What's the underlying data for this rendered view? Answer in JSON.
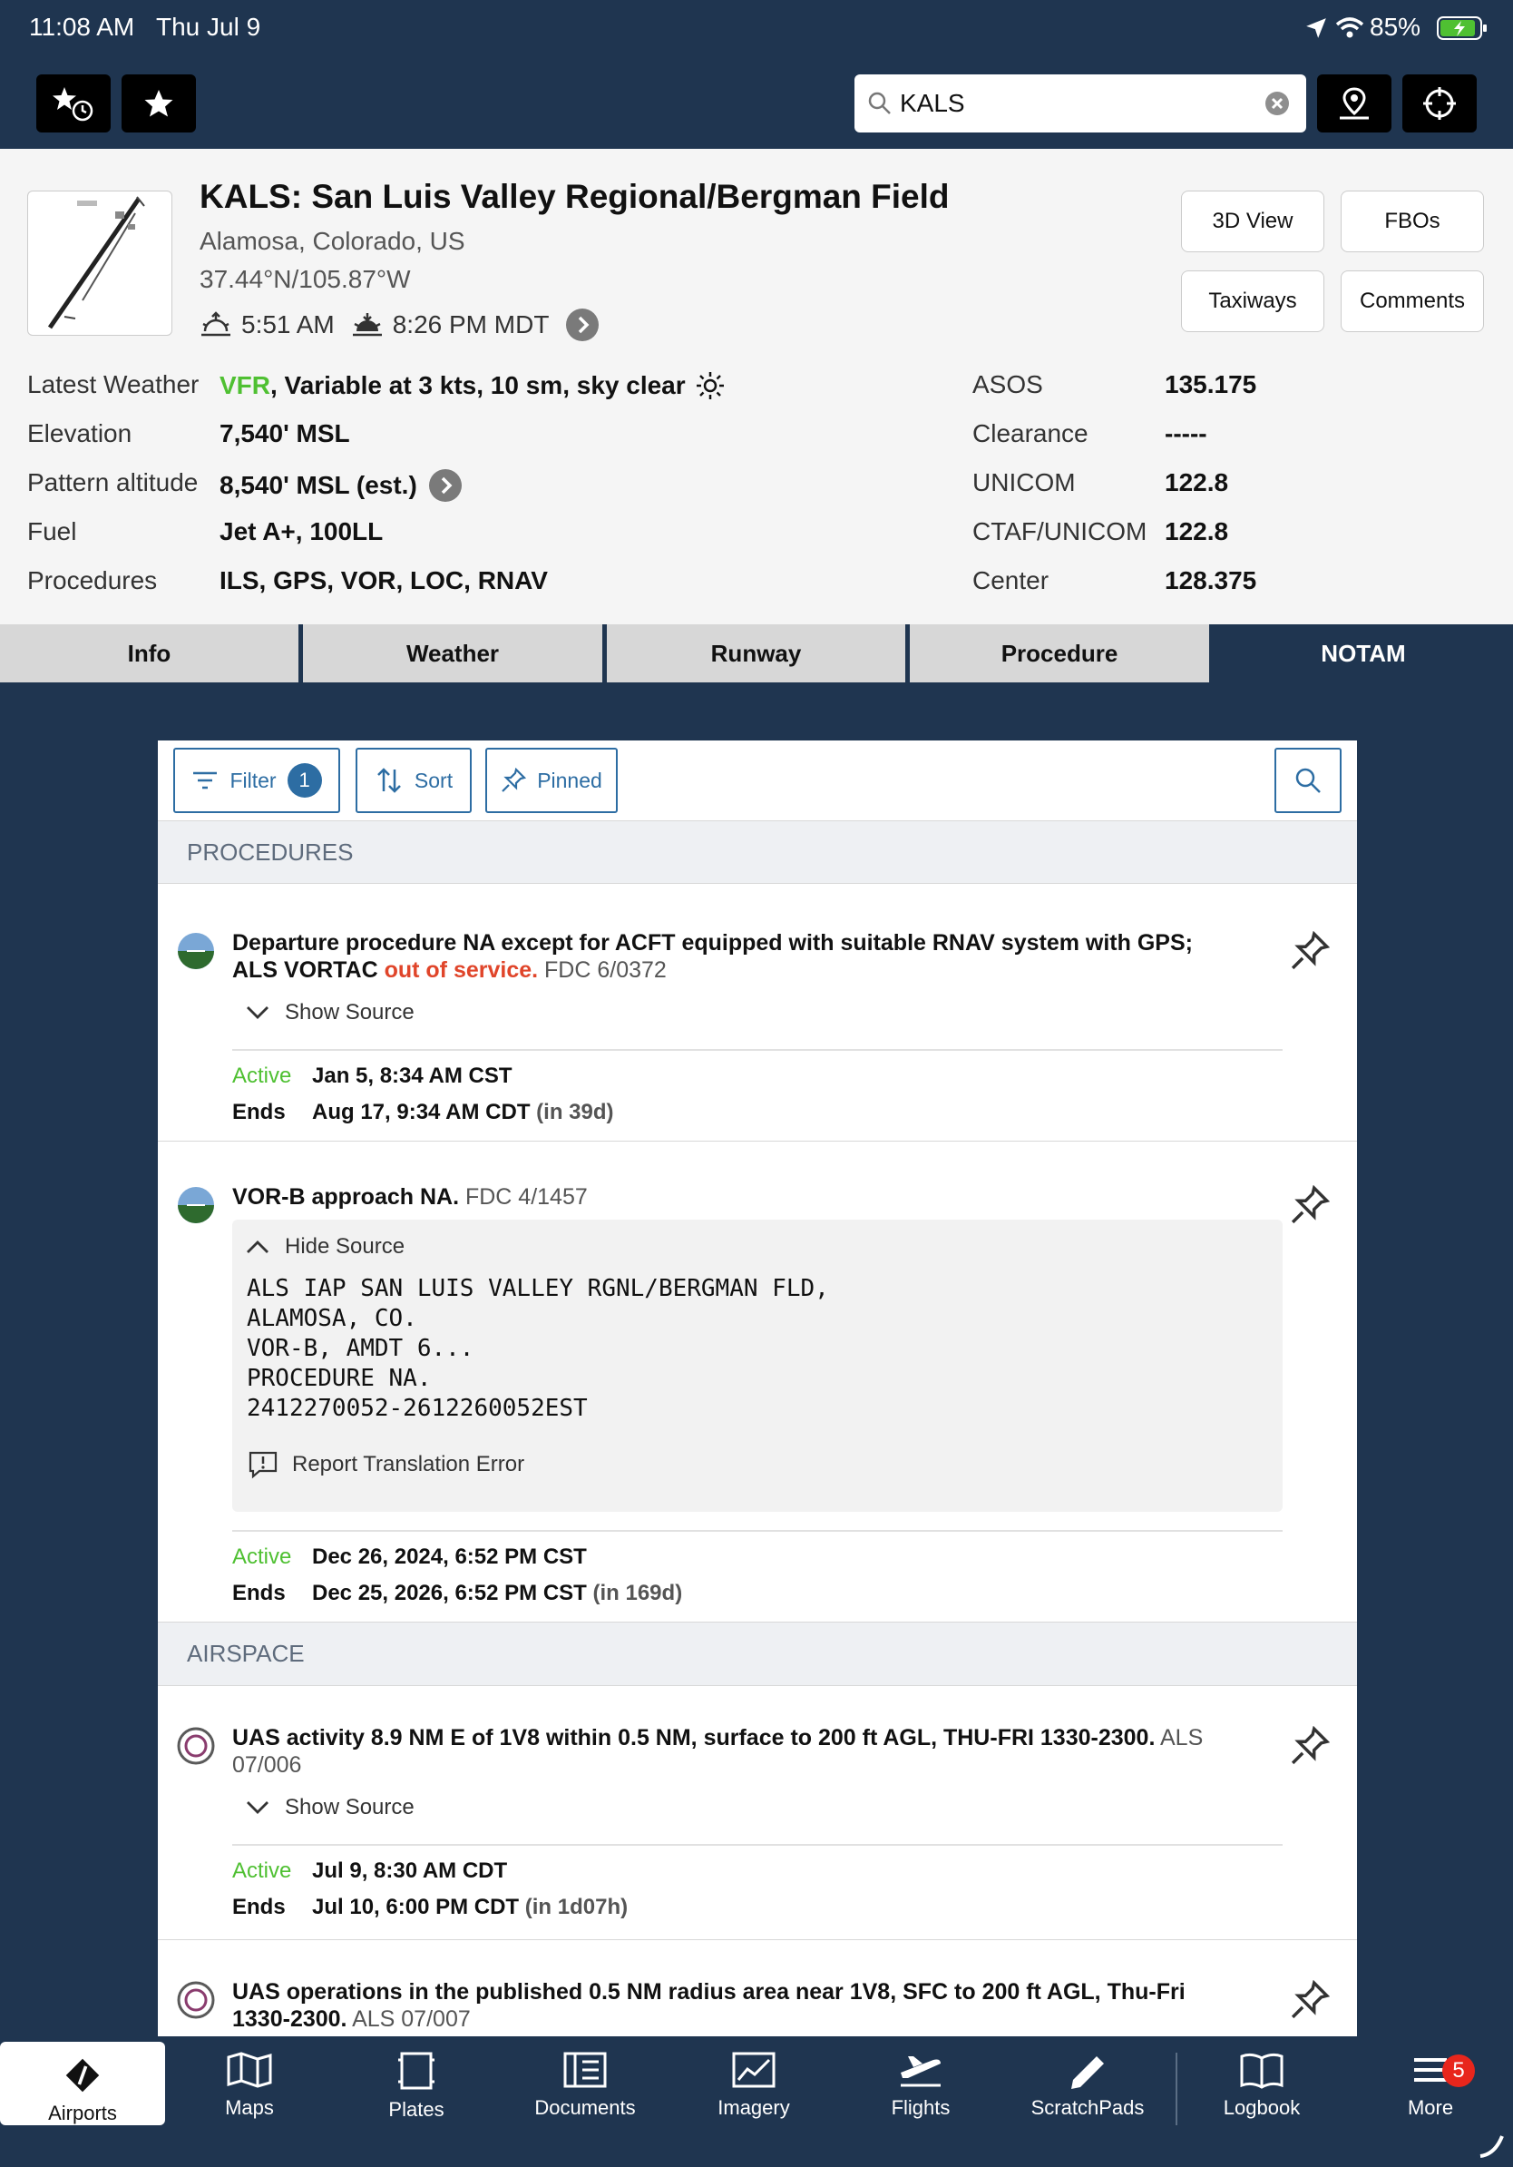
{
  "status_bar": {
    "time": "11:08 AM",
    "date": "Thu Jul 9",
    "battery": "85%"
  },
  "search": {
    "value": "KALS"
  },
  "airport": {
    "title": "KALS: San Luis Valley Regional/Bergman Field",
    "location": "Alamosa, Colorado, US",
    "coords": "37.44°N/105.87°W",
    "sunrise": "5:51 AM",
    "sunset": "8:26 PM MDT",
    "buttons": {
      "view3d": "3D View",
      "fbos": "FBOs",
      "taxiways": "Taxiways",
      "comments": "Comments"
    }
  },
  "info": {
    "weather_label": "Latest Weather",
    "weather_cat": "VFR",
    "weather_text": ", Variable at 3 kts, 10 sm, sky clear",
    "elevation_label": "Elevation",
    "elevation": "7,540' MSL",
    "pattern_label": "Pattern altitude",
    "pattern": "8,540' MSL (est.)",
    "fuel_label": "Fuel",
    "fuel": "Jet A+, 100LL",
    "procedures_label": "Procedures",
    "procedures": "ILS, GPS, VOR, LOC, RNAV",
    "asos_label": "ASOS",
    "asos": "135.175",
    "clearance_label": "Clearance",
    "clearance": "-----",
    "unicom_label": "UNICOM",
    "unicom": "122.8",
    "ctaf_label": "CTAF/UNICOM",
    "ctaf": "122.8",
    "center_label": "Center",
    "center": "128.375"
  },
  "tabs": [
    "Info",
    "Weather",
    "Runway",
    "Procedure",
    "NOTAM"
  ],
  "toolbar": {
    "filter": "Filter",
    "filter_count": "1",
    "sort": "Sort",
    "pinned": "Pinned"
  },
  "sections": {
    "procedures": "PROCEDURES",
    "airspace": "AIRSPACE"
  },
  "notams": [
    {
      "text_a": "Departure procedure NA except for ACFT equipped with suitable RNAV system with GPS; ALS VORTAC ",
      "text_red": "out of service.",
      "id": " FDC 6/0372",
      "toggle": "Show Source",
      "active_label": "Active",
      "active": "Jan 5, 8:34 AM CST",
      "ends_label": "Ends",
      "ends": "Aug 17, 9:34 AM CDT",
      "rel": "(in 39d)"
    },
    {
      "text_a": "VOR-B approach NA.",
      "id": " FDC 4/1457",
      "toggle": "Hide Source",
      "source": [
        "ALS IAP SAN LUIS VALLEY RGNL/BERGMAN FLD,",
        "ALAMOSA, CO.",
        "VOR-B, AMDT 6...",
        "PROCEDURE NA.",
        "2412270052-2612260052EST"
      ],
      "report": "Report Translation Error",
      "active_label": "Active",
      "active": "Dec 26, 2024, 6:52 PM CST",
      "ends_label": "Ends",
      "ends": "Dec 25, 2026, 6:52 PM CST",
      "rel": "(in 169d)"
    },
    {
      "text_a": "UAS activity 8.9 NM E of 1V8 within 0.5 NM, surface to 200 ft AGL, THU-FRI 1330-2300.",
      "id": " ALS 07/006",
      "toggle": "Show Source",
      "active_label": "Active",
      "active": "Jul 9, 8:30 AM CDT",
      "ends_label": "Ends",
      "ends": "Jul 10, 6:00 PM CDT",
      "rel": "(in 1d07h)"
    },
    {
      "text_a": "UAS operations in the published 0.5 NM radius area near 1V8, SFC to 200 ft AGL, Thu-Fri 1330-2300.",
      "id": " ALS 07/007"
    }
  ],
  "bottom_nav": [
    "Airports",
    "Maps",
    "Plates",
    "Documents",
    "Imagery",
    "Flights",
    "ScratchPads",
    "Logbook",
    "More"
  ],
  "more_badge": "5",
  "colors": {
    "navy": "#1f3550",
    "vfr": "#4fc032",
    "red": "#e0452a",
    "blue": "#2d6da3",
    "badge": "#e8261c"
  }
}
